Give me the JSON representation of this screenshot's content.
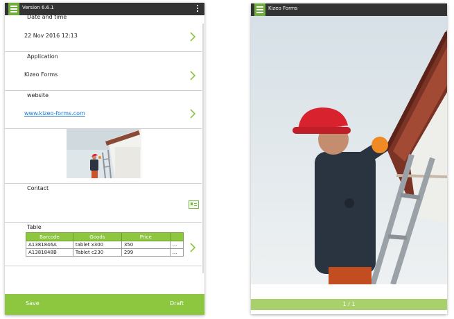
{
  "left_screen": {
    "top_bar": {
      "version": "Version 6.6.1"
    },
    "fields": [
      {
        "label": "Date and time",
        "value": "22 Nov 2016 12:13"
      },
      {
        "label": "Application",
        "value": "Kizeo Forms"
      },
      {
        "label": "website",
        "value": "www.kizeo-forms.com"
      },
      {
        "label": "Contact"
      },
      {
        "label": "Table"
      }
    ],
    "table": {
      "headers": [
        "Barcode",
        "Goods",
        "Price",
        ""
      ],
      "rows": [
        [
          "A1381846A",
          "tablet x300",
          "350",
          "..."
        ],
        [
          "A1381848B",
          "Tablet c230",
          "299",
          "..."
        ]
      ]
    },
    "footer": {
      "save_label": "Save",
      "draft_label": "Draft"
    }
  },
  "right_screen": {
    "top_bar": {
      "title": "Kizeo Forms"
    },
    "pager": "1 / 1"
  },
  "colors": {
    "accent": "#8dc63f",
    "top_bar": "#333333",
    "link": "#1a73c9"
  }
}
